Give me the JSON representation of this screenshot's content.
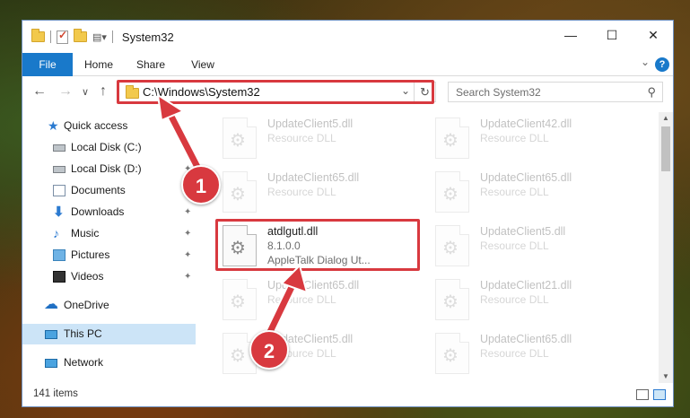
{
  "window": {
    "title": "System32",
    "controls": {
      "minimize": "—",
      "maximize": "☐",
      "close": "✕"
    }
  },
  "ribbon": {
    "tabs": [
      "File",
      "Home",
      "Share",
      "View"
    ]
  },
  "navigation": {
    "back": "←",
    "forward": "→",
    "recent": "∨",
    "up": "↑",
    "address": "C:\\Windows\\System32",
    "search_placeholder": "Search System32"
  },
  "sidebar": {
    "items": [
      {
        "label": "Quick access",
        "icon": "star-icon",
        "pinned": false
      },
      {
        "label": "Local Disk (C:)",
        "icon": "disk-icon",
        "pinned": true
      },
      {
        "label": "Local Disk (D:)",
        "icon": "disk-icon",
        "pinned": true
      },
      {
        "label": "Documents",
        "icon": "documents-icon",
        "pinned": true
      },
      {
        "label": "Downloads",
        "icon": "download-icon",
        "pinned": true
      },
      {
        "label": "Music",
        "icon": "music-icon",
        "pinned": true
      },
      {
        "label": "Pictures",
        "icon": "pictures-icon",
        "pinned": true
      },
      {
        "label": "Videos",
        "icon": "videos-icon",
        "pinned": true
      },
      {
        "label": "OneDrive",
        "icon": "cloud-icon",
        "pinned": false
      },
      {
        "label": "This PC",
        "icon": "pc-icon",
        "pinned": false,
        "selected": true
      },
      {
        "label": "Network",
        "icon": "network-icon",
        "pinned": false
      }
    ]
  },
  "files": {
    "left_column": [
      {
        "name": "UpdateClient5.dll",
        "desc": "Resource DLL"
      },
      {
        "name": "UpdateClient65.dll",
        "desc": "Resource DLL"
      },
      {
        "name": "atdlgutl.dll",
        "version": "8.1.0.0",
        "desc": "AppleTalk Dialog Ut..."
      },
      {
        "name": "UpdateClient65.dll",
        "desc": "Resource DLL"
      },
      {
        "name": "UpdateClient5.dll",
        "desc": "Resource DLL"
      }
    ],
    "right_column": [
      {
        "name": "UpdateClient42.dll",
        "desc": "Resource DLL"
      },
      {
        "name": "UpdateClient65.dll",
        "desc": "Resource DLL"
      },
      {
        "name": "UpdateClient5.dll",
        "desc": "Resource DLL"
      },
      {
        "name": "UpdateClient21.dll",
        "desc": "Resource DLL"
      },
      {
        "name": "UpdateClient65.dll",
        "desc": "Resource DLL"
      }
    ]
  },
  "status": {
    "item_count": "141 items"
  },
  "callouts": [
    "1",
    "2"
  ],
  "colors": {
    "accent": "#1979ca",
    "highlight_red": "#d8393f",
    "selected_bg": "#cce4f7"
  }
}
